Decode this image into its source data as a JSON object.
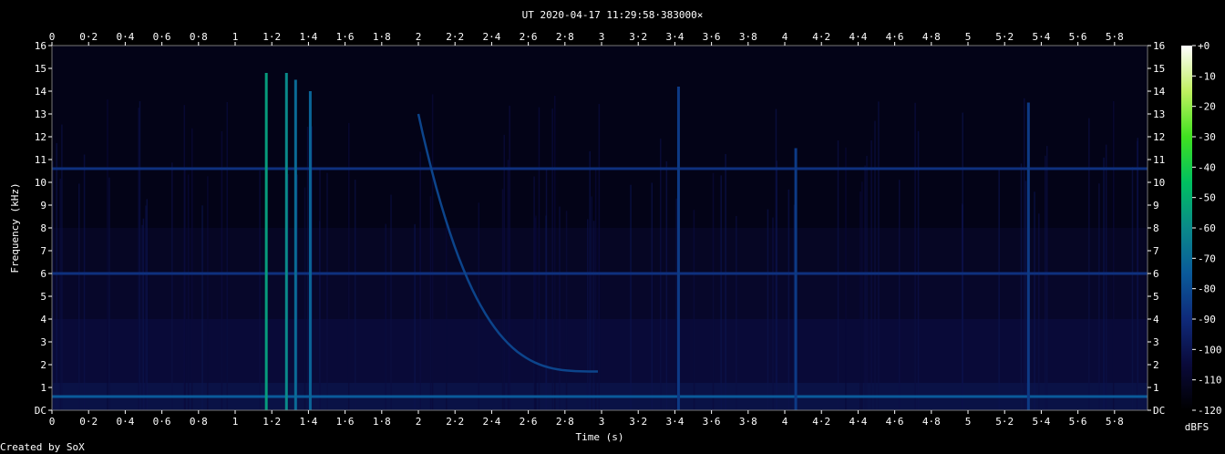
{
  "chart_data": {
    "type": "heatmap",
    "title": "UT 2020-04-17 11:29:58·383000×",
    "xlabel": "Time (s)",
    "ylabel": "Frequency (kHz)",
    "colorbar_label": "dBFS",
    "credit": "Created by SoX",
    "xlim": [
      0,
      5.98
    ],
    "ylim": [
      0,
      16
    ],
    "clim": [
      -120,
      0
    ],
    "x_ticks": [
      "0",
      "0·2",
      "0·4",
      "0·6",
      "0·8",
      "1",
      "1·2",
      "1·4",
      "1·6",
      "1·8",
      "2",
      "2·2",
      "2·4",
      "2·6",
      "2·8",
      "3",
      "3·2",
      "3·4",
      "3·6",
      "3·8",
      "4",
      "4·2",
      "4·4",
      "4·6",
      "4·8",
      "5",
      "5·2",
      "5·4",
      "5·6",
      "5·8"
    ],
    "x_tick_values": [
      0,
      0.2,
      0.4,
      0.6,
      0.8,
      1,
      1.2,
      1.4,
      1.6,
      1.8,
      2,
      2.2,
      2.4,
      2.6,
      2.8,
      3,
      3.2,
      3.4,
      3.6,
      3.8,
      4,
      4.2,
      4.4,
      4.6,
      4.8,
      5,
      5.2,
      5.4,
      5.6,
      5.8
    ],
    "y_ticks": [
      "DC",
      "1",
      "2",
      "3",
      "4",
      "5",
      "6",
      "7",
      "8",
      "9",
      "10",
      "11",
      "12",
      "13",
      "14",
      "15",
      "16"
    ],
    "y_tick_values": [
      0,
      1,
      2,
      3,
      4,
      5,
      6,
      7,
      8,
      9,
      10,
      11,
      12,
      13,
      14,
      15,
      16
    ],
    "colorbar_ticks": [
      "+0",
      "-10",
      "-20",
      "-30",
      "-40",
      "-50",
      "-60",
      "-70",
      "-80",
      "-90",
      "-100",
      "-110",
      "-120"
    ],
    "colorbar_tick_values": [
      0,
      -10,
      -20,
      -30,
      -40,
      -50,
      -60,
      -70,
      -80,
      -90,
      -100,
      -110,
      -120
    ],
    "colormap": [
      "#000000",
      "#0a0a3a",
      "#0f2a7a",
      "#0a5a9a",
      "#0a8a8a",
      "#00c060",
      "#40e020",
      "#c0f060",
      "#ffffff"
    ],
    "features": {
      "hum_lines_khz": [
        0.6,
        6.0,
        10.6
      ],
      "impulses": [
        {
          "t": 1.17,
          "fmax": 14.8,
          "level": -55
        },
        {
          "t": 1.28,
          "fmax": 14.8,
          "level": -60
        },
        {
          "t": 1.33,
          "fmax": 14.5,
          "level": -70
        },
        {
          "t": 1.41,
          "fmax": 14.0,
          "level": -72
        },
        {
          "t": 3.42,
          "fmax": 14.2,
          "level": -85
        },
        {
          "t": 4.06,
          "fmax": 11.5,
          "level": -85
        },
        {
          "t": 5.33,
          "fmax": 13.5,
          "level": -85
        }
      ],
      "whistler": {
        "t_start": 2.0,
        "t_end": 2.98,
        "f_start": 13.0,
        "f_end": 1.7,
        "level": -82
      }
    }
  }
}
